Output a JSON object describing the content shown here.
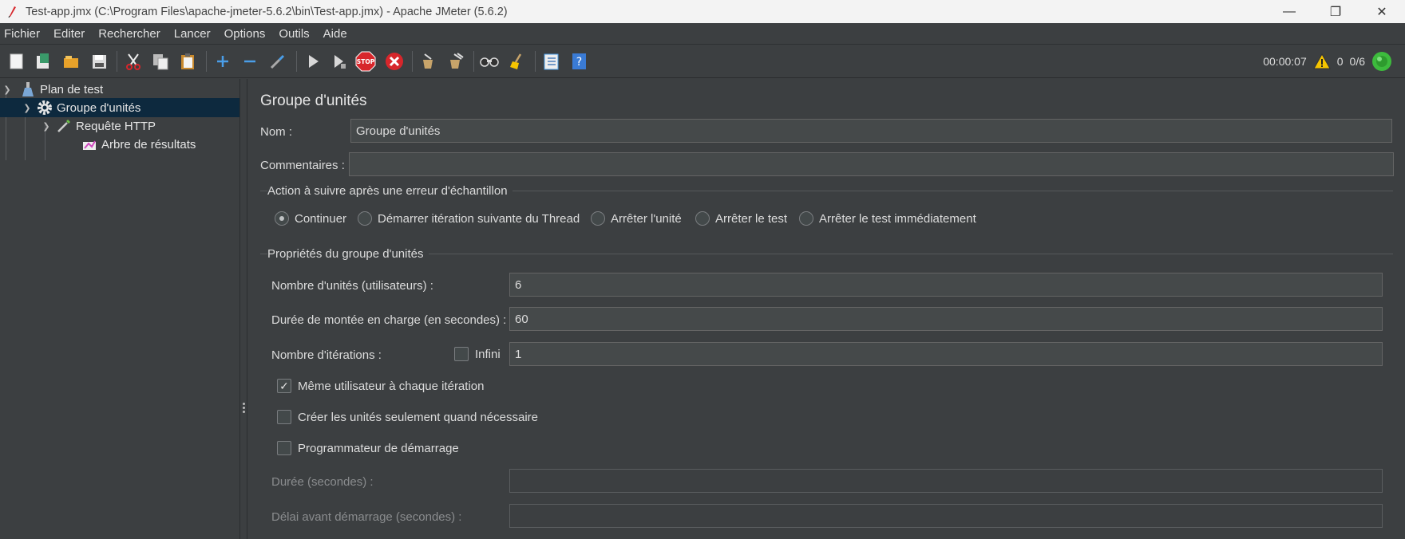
{
  "window": {
    "title": "Test-app.jmx (C:\\Program Files\\apache-jmeter-5.6.2\\bin\\Test-app.jmx) - Apache JMeter (5.6.2)",
    "minimize": "—",
    "maximize": "❐",
    "close": "✕"
  },
  "menu": [
    "Fichier",
    "Editer",
    "Rechercher",
    "Lancer",
    "Options",
    "Outils",
    "Aide"
  ],
  "toolbar": {
    "timer": "00:00:07",
    "warnings": "0",
    "threads": "0/6",
    "icons": [
      "new-icon",
      "templates-icon",
      "open-icon",
      "save-icon",
      "cut-icon",
      "copy-icon",
      "paste-icon",
      "expand-icon",
      "collapse-icon",
      "toggle-icon",
      "start-icon",
      "start-no-pause-icon",
      "stop-icon",
      "shutdown-icon",
      "clear-icon",
      "clear-all-icon",
      "search-icon",
      "reset-search-icon",
      "function-helper-icon",
      "help-icon"
    ],
    "colors": {
      "stop": "#d7262b",
      "status_ok": "#3dbb3d",
      "warning": "#f5c400"
    }
  },
  "tree": {
    "items": [
      {
        "label": "Plan de test",
        "icon": "test-plan-icon"
      },
      {
        "label": "Groupe d'unités",
        "icon": "thread-group-gear-icon",
        "selected": true
      },
      {
        "label": "Requête HTTP",
        "icon": "http-sampler-pipette-icon"
      },
      {
        "label": "Arbre de résultats",
        "icon": "results-tree-icon"
      }
    ]
  },
  "panel": {
    "heading": "Groupe d'unités",
    "name_label": "Nom :",
    "name_value": "Groupe d'unités",
    "comments_label": "Commentaires :",
    "comments_value": "",
    "action_section": "Action à suivre après une erreur d'échantillon",
    "actions": [
      {
        "label": "Continuer",
        "selected": true
      },
      {
        "label": "Démarrer itération suivante du Thread",
        "selected": false
      },
      {
        "label": "Arrêter l'unité",
        "selected": false
      },
      {
        "label": "Arrêter le test",
        "selected": false
      },
      {
        "label": "Arrêter le test immédiatement",
        "selected": false
      }
    ],
    "props_section": "Propriétés du groupe d'unités",
    "threads_label": "Nombre d'unités (utilisateurs) :",
    "threads_value": "6",
    "rampup_label": "Durée de montée en charge (en secondes) :",
    "rampup_value": "60",
    "loops_label": "Nombre d'itérations :",
    "infinite_label": "Infini",
    "infinite_checked": false,
    "loops_value": "1",
    "same_user_label": "Même utilisateur à chaque itération",
    "same_user_checked": true,
    "delay_create_label": "Créer les unités seulement quand nécessaire",
    "delay_create_checked": false,
    "scheduler_label": "Programmateur de démarrage",
    "scheduler_checked": false,
    "duration_label": "Durée (secondes) :",
    "duration_value": "",
    "startup_delay_label": "Délai avant démarrage (secondes) :",
    "startup_delay_value": ""
  }
}
